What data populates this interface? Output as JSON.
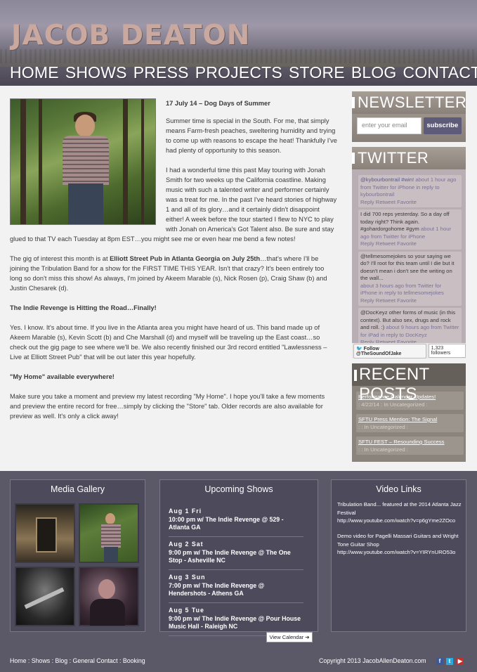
{
  "site": {
    "title": "JACOB DEATON",
    "nav": [
      "HOME",
      "SHOWS",
      "PRESS",
      "PROJECTS",
      "STORE",
      "BLOG",
      "CONTACT"
    ]
  },
  "post": {
    "title": "17 July 14 – Dog Days of Summer",
    "p1": "Summer time is special in the South.  For me, that simply means Farm-fresh peaches, sweltering humidity and trying to come up with reasons to escape the heat!  Thankfully I've had plenty of opportunity to this season.",
    "p2": "I had a wonderful time this past May touring with Jonah Smith for two weeks up the California coastline.  Making music with such a talented writer and performer certainly was a treat for me.  In the past I've heard stories of highway 1 and all of its glory…and it certainly didn't disappoint either!  A week before the tour started I flew to NYC to play with Jonah on America's Got Talent also.  Be sure and stay glued to that TV each Tuesday at 8pm EST…you might see me or even hear me bend a few notes!",
    "p3_pre": "The gig of interest this month is at ",
    "p3_bold": "Elliott Street Pub in Atlanta Georgia on July 25th",
    "p3_post": "…that's where I'll be joining the Tribulation Band for a show for the FIRST TIME THIS YEAR.  Isn't that crazy?  It's been entirely too long so don't miss this show!  As always, I'm joined by Akeem Marable (s), Nick Rosen (p), Craig Shaw (b) and Justin Chesarek (d).",
    "h2": "The Indie Revenge is Hitting the Road…Finally!",
    "p4": "Yes.  I know.  It's about time.  If you live in the Atlanta area you might have heard of us.  This band made up of Akeem Marable (s), Kevin Scott (b) and Che Marshall (d) and myself will be traveling up the East coast…so check out the gig page to see where we'll be.  We also recently finished our 3rd record entitled \"Lawlessness – Live at Elliott Street Pub\" that will be out later this year hopefully.",
    "h3": "\"My Home\" available everywhere!",
    "p5": "Make sure you take a moment and preview my latest recording \"My Home\".  I hope you'll take a few moments and preview the entire record for free…simply by clicking the \"Store\" tab.  Older records are also available for preview as well.  It's only a click away!"
  },
  "newsletter": {
    "heading": "NEWSLETTER",
    "placeholder": "enter your email",
    "button": "subscribe"
  },
  "twitter": {
    "heading": "TWITTER",
    "tweets": [
      {
        "text": "@kybourbontrail #win!",
        "meta": " about 1 hour ago from Twitter for iPhone in reply to kybourbontrail",
        "actions": "Reply Retweet Favorite"
      },
      {
        "text": "I did 700 reps yesterday. So a day off today right? Think again. #gohardorgohome #gym",
        "meta": " about 1 hour ago from Twitter for iPhone",
        "actions": "Reply Retweet Favorite"
      },
      {
        "text": "@tellmesomejokes so your saying we do? I'll root for this team until I die but it doesn't mean i don't see the writing on the wall...",
        "meta": "about 3 hours ago from Twitter for iPhone in reply to tellmesomejokes",
        "actions": "Reply Retweet Favorite"
      },
      {
        "text": "@DocKeyz other forms of music (in this context). But also sex, drugs and rock and roll. :)",
        "meta": " about 9 hours ago from Twitter for iPad in reply to DocKeyz",
        "actions": "Reply Retweet Favorite"
      }
    ],
    "follow": "Follow @TheSoundOfJake",
    "followers": "1,323 followers"
  },
  "recent": {
    "heading": "RECENT POSTS",
    "items": [
      {
        "title": "Performance Calendar Updates!",
        "meta": ": 4/22/14 : In Uncategorized :"
      },
      {
        "title": "SFTU Press Mention: The Signal",
        "meta": ": : In Uncategorized :"
      },
      {
        "title": "SFTU FEST – Resounding Success",
        "meta": ": : In Uncategorized :"
      }
    ]
  },
  "gallery": {
    "heading": "Media Gallery"
  },
  "shows": {
    "heading": "Upcoming Shows",
    "items": [
      {
        "date": "Aug 1 Fri",
        "info": "10:00 pm w/ The Indie Revenge @ 529 - Atlanta GA"
      },
      {
        "date": "Aug 2 Sat",
        "info": "9:00 pm w/ The Indie Revenge @ The One Stop - Asheville NC"
      },
      {
        "date": "Aug 3 Sun",
        "info": "7:00 pm w/ The Indie Revenge @ Hendershots - Athens GA"
      },
      {
        "date": "Aug 5 Tue",
        "info": "9:00 pm w/ The Indie Revenge @ Pour House Music Hall - Raleigh NC"
      }
    ],
    "calendar_button": "View Calendar ➔"
  },
  "videos": {
    "heading": "Video Links",
    "items": [
      {
        "title": "Tribulation Band... featured at the 2014 Atlanta Jazz Festival",
        "url": "http://www.youtube.com/watch?v=p6gYme2ZOco"
      },
      {
        "title": "Demo video for Pagelli Massari Guitars and Wright Tone Guitar Shop",
        "url": "http://www.youtube.com/watch?v=YIRYnURO53o"
      }
    ]
  },
  "footer": {
    "links": "Home : Shows : Blog : General Contact : Booking",
    "copyright": "Copyright 2013 JacobAllenDeaton.com"
  },
  "colors": {
    "footer_bg": "#5b5868",
    "panel_bg": "#4d4a5c",
    "logo": "#c9a8a0",
    "subscribe": "#5d5a7a"
  },
  "icons": [
    "facebook-icon",
    "twitter-icon",
    "youtube-icon",
    "twitter-bird-icon",
    "arrow-right-icon"
  ]
}
